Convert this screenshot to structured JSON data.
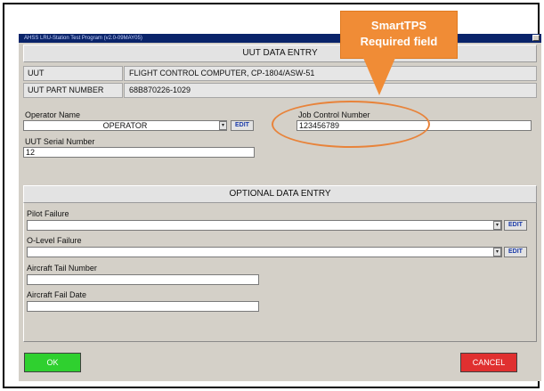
{
  "window": {
    "title": "AHSS LRU-Station Test Program (v2.0-09MAY05)",
    "close_glyph": "x"
  },
  "uut_section": {
    "header": "UUT DATA ENTRY",
    "uut_label": "UUT",
    "uut_value": "FLIGHT CONTROL COMPUTER,  CP-1804/ASW-51",
    "part_label": "UUT PART NUMBER",
    "part_value": "68B870226-1029"
  },
  "operator": {
    "label": "Operator Name",
    "value": "OPERATOR",
    "edit_label": "EDIT"
  },
  "job_control": {
    "label": "Job Control Number",
    "value": "123456789"
  },
  "serial": {
    "label": "UUT Serial Number",
    "value": "12"
  },
  "optional_section": {
    "header": "OPTIONAL DATA ENTRY",
    "pilot_failure_label": "Pilot Failure",
    "pilot_failure_value": "",
    "olevel_failure_label": "O-Level Failure",
    "olevel_failure_value": "",
    "tail_number_label": "Aircraft Tail Number",
    "tail_number_value": "",
    "fail_date_label": "Aircraft Fail Date",
    "fail_date_value": "",
    "edit_label": "EDIT"
  },
  "buttons": {
    "ok_label": "OK",
    "cancel_label": "CANCEL"
  },
  "callout": {
    "line1": "SmartTPS",
    "line2": "Required field"
  },
  "colors": {
    "ok_button": "#2fd02f",
    "cancel_button": "#e03030",
    "callout": "#f08c36",
    "edit_text": "#1a3aa8"
  },
  "icons": {
    "dropdown": "▾"
  }
}
